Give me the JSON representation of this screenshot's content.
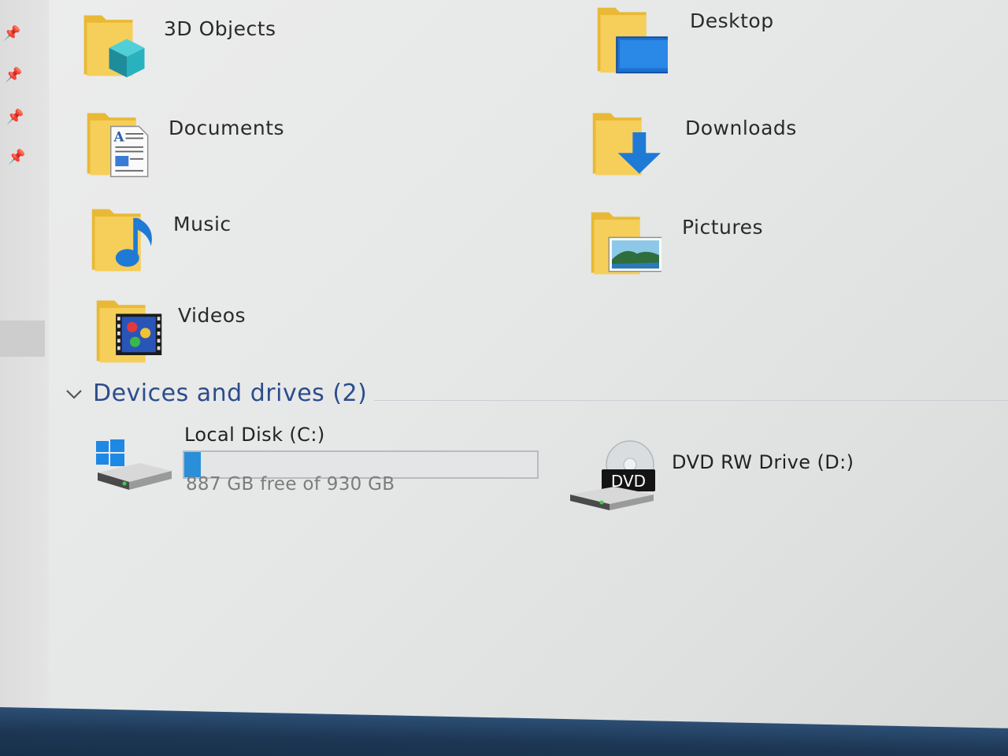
{
  "folders": [
    {
      "label": "3D Objects",
      "icon": "3d-objects-folder-icon"
    },
    {
      "label": "Desktop",
      "icon": "desktop-folder-icon"
    },
    {
      "label": "Documents",
      "icon": "documents-folder-icon"
    },
    {
      "label": "Downloads",
      "icon": "downloads-folder-icon"
    },
    {
      "label": "Music",
      "icon": "music-folder-icon"
    },
    {
      "label": "Pictures",
      "icon": "pictures-folder-icon"
    },
    {
      "label": "Videos",
      "icon": "videos-folder-icon"
    }
  ],
  "devices_section": {
    "title": "Devices and drives (2)"
  },
  "drives": [
    {
      "name": "Local Disk (C:)",
      "free_text": "887 GB free of 930 GB",
      "used_fraction": 0.046,
      "icon": "hard-drive-icon"
    },
    {
      "name": "DVD RW Drive (D:)",
      "badge": "DVD",
      "icon": "dvd-drive-icon"
    }
  ],
  "colors": {
    "folder_yellow": "#f3c84a",
    "accent_blue": "#1f7ad6",
    "section_title": "#2c4c8c",
    "capacity_fill": "#2a8fd8"
  }
}
